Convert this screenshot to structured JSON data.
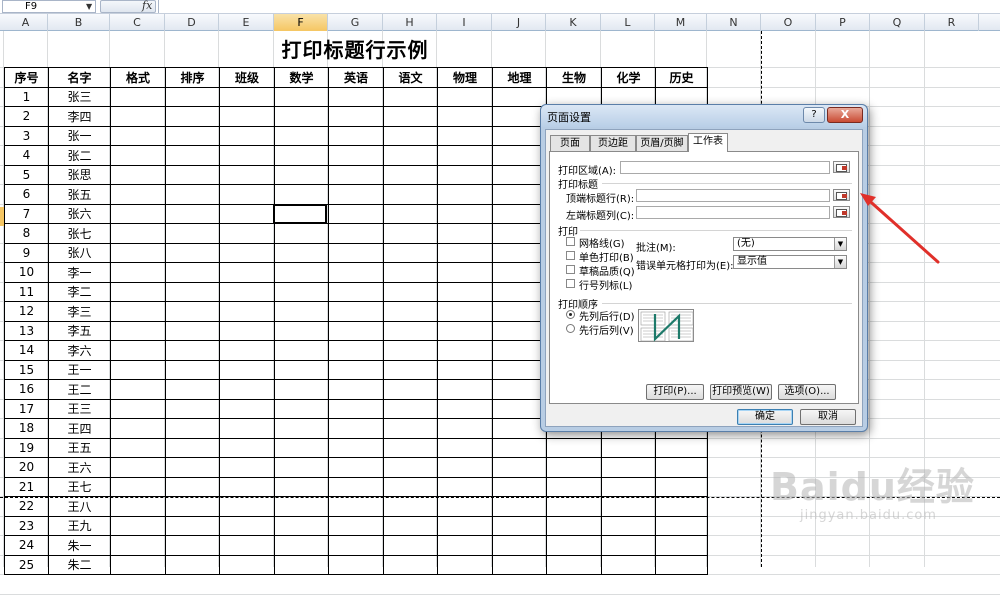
{
  "formula_bar": {
    "name_box": "F9",
    "fx_label": "fx",
    "formula": ""
  },
  "columns": [
    "A",
    "B",
    "C",
    "D",
    "E",
    "F",
    "G",
    "H",
    "I",
    "J",
    "K",
    "L",
    "M",
    "N",
    "O",
    "P",
    "Q",
    "R"
  ],
  "selected_column": "F",
  "sheet": {
    "title": "打印标题行示例",
    "headers": [
      "序号",
      "名字",
      "格式",
      "排序",
      "班级",
      "数学",
      "英语",
      "语文",
      "物理",
      "地理",
      "生物",
      "化学",
      "历史"
    ],
    "rows": [
      [
        "1",
        "张三"
      ],
      [
        "2",
        "李四"
      ],
      [
        "3",
        "张一"
      ],
      [
        "4",
        "张二"
      ],
      [
        "5",
        "张思"
      ],
      [
        "6",
        "张五"
      ],
      [
        "7",
        "张六"
      ],
      [
        "8",
        "张七"
      ],
      [
        "9",
        "张八"
      ],
      [
        "10",
        "李一"
      ],
      [
        "11",
        "李二"
      ],
      [
        "12",
        "李三"
      ],
      [
        "13",
        "李五"
      ],
      [
        "14",
        "李六"
      ],
      [
        "15",
        "王一"
      ],
      [
        "16",
        "王二"
      ],
      [
        "17",
        "王三"
      ],
      [
        "18",
        "王四"
      ],
      [
        "19",
        "王五"
      ],
      [
        "20",
        "王六"
      ],
      [
        "21",
        "王七"
      ],
      [
        "22",
        "王八"
      ],
      [
        "23",
        "王九"
      ],
      [
        "24",
        "朱一"
      ],
      [
        "25",
        "朱二"
      ]
    ]
  },
  "dialog": {
    "title": "页面设置",
    "help": "?",
    "close": "X",
    "tabs": [
      "页面",
      "页边距",
      "页眉/页脚",
      "工作表"
    ],
    "active_tab": "工作表",
    "print_area_label": "打印区域(A):",
    "print_titles_label": "打印标题",
    "top_rows_label": "顶端标题行(R):",
    "left_cols_label": "左端标题列(C):",
    "print_label": "打印",
    "checkboxes": [
      "网格线(G)",
      "单色打印(B)",
      "草稿品质(Q)",
      "行号列标(L)"
    ],
    "comments_label": "批注(M):",
    "comments_value": "(无)",
    "errors_label": "错误单元格打印为(E):",
    "errors_value": "显示值",
    "order_label": "打印顺序",
    "order_options": [
      "先列后行(D)",
      "先行后列(V)"
    ],
    "order_selected": 0,
    "buttons": {
      "print": "打印(P)...",
      "preview": "打印预览(W)",
      "options": "选项(O)..."
    },
    "ok": "确定",
    "cancel": "取消"
  },
  "watermark": {
    "logo": "Baidu经验",
    "sub": "jingyan.baidu.com"
  },
  "colors": {
    "accent_arrow": "#e0302a",
    "dialog_frame": "#b8cde4",
    "selected_header": "#f5c663"
  }
}
